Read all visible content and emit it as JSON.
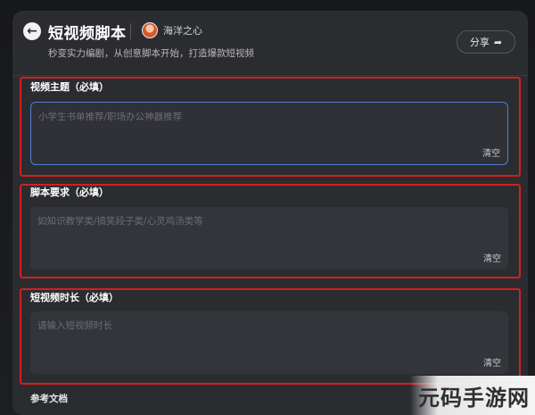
{
  "header": {
    "title": "短视频脚本",
    "author": "海洋之心",
    "subtitle": "秒变实力编剧，从创意脚本开始，打造爆款短视频",
    "share_label": "分享"
  },
  "sections": [
    {
      "label": "视频主题（必填）",
      "placeholder": "小学生书单推荐/职场办公神器推荐",
      "clear_label": "清空"
    },
    {
      "label": "脚本要求（必填）",
      "placeholder": "如知识教学类/搞笑段子类/心灵鸡汤类等",
      "clear_label": "清空"
    },
    {
      "label": "短视频时长（必填）",
      "placeholder": "请输入短视频时长",
      "clear_label": "清空"
    }
  ],
  "footer": {
    "label": "参考文档"
  },
  "watermark": {
    "text": "元码手游网"
  },
  "colors": {
    "highlight_border": "#d21f1f",
    "focus_border": "#4d7fd6",
    "card_bg": "#2b2c30"
  }
}
